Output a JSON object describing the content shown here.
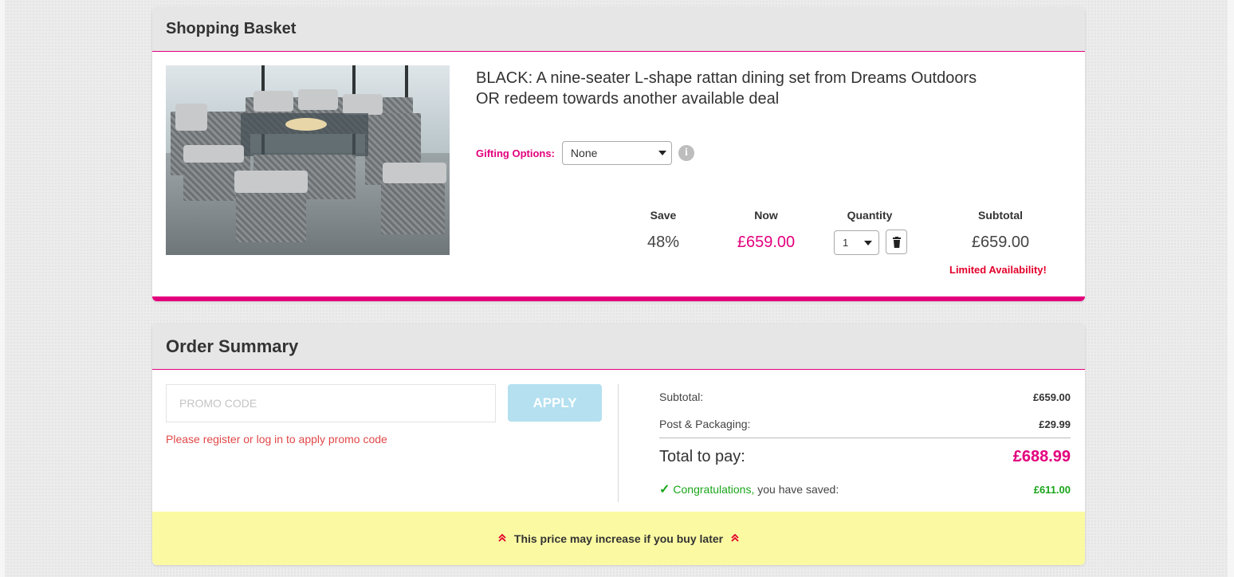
{
  "basket": {
    "heading": "Shopping Basket",
    "product": {
      "title_line1": "BLACK: A nine-seater L-shape rattan dining set from Dreams Outdoors",
      "title_line2": "OR redeem towards another available deal",
      "image_icon": "product-photo-rattan-dining-set"
    },
    "gifting": {
      "label": "Gifting Options:",
      "selected": "None",
      "info_icon": "info-icon",
      "info_glyph": "i"
    },
    "columns": {
      "save_label": "Save",
      "now_label": "Now",
      "quantity_label": "Quantity",
      "subtotal_label": "Subtotal"
    },
    "values": {
      "save": "48%",
      "now": "£659.00",
      "quantity": "1",
      "subtotal": "£659.00"
    },
    "availability": "Limited Availability!"
  },
  "summary": {
    "heading": "Order Summary",
    "promo": {
      "placeholder": "PROMO CODE",
      "value": "",
      "apply_label": "APPLY",
      "message": "Please register or log in to apply promo code"
    },
    "lines": {
      "subtotal_label": "Subtotal:",
      "subtotal_value": "£659.00",
      "postage_label": "Post & Packaging:",
      "postage_value": "£29.99",
      "total_label": "Total to pay:",
      "total_value": "£688.99",
      "tick": "✓",
      "congrats": "Congratulations,",
      "saved_text": " you have saved:",
      "saved_value": "£611.00"
    },
    "warning": {
      "text": "This price may increase if you buy later",
      "icon": "double-chevron-up-icon",
      "glyph": "⌃"
    }
  },
  "colors": {
    "brand_pink": "#e3007d",
    "alert_red": "#e3002a",
    "success_green": "#1aa61a",
    "apply_blue": "#b4e0f0",
    "warning_yellow": "#fbfaa3"
  }
}
